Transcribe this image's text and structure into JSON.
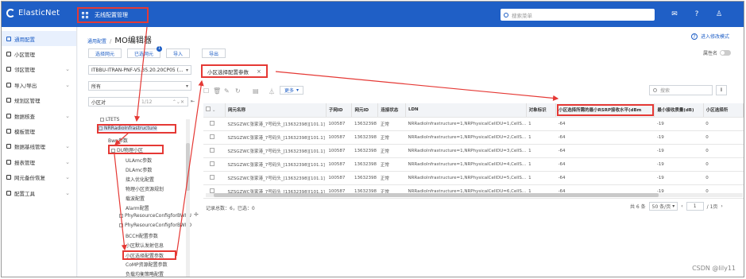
{
  "app": {
    "title": "ElasticNet"
  },
  "topbar": {
    "menu_label": "无线配置管理",
    "search_placeholder": "搜索菜单"
  },
  "sidebar": {
    "items": [
      {
        "label": "通用配置",
        "active": true
      },
      {
        "label": "小区管理"
      },
      {
        "label": "邻区管理"
      },
      {
        "label": "导入/导出"
      },
      {
        "label": "规划区管理"
      },
      {
        "label": "数据核查"
      },
      {
        "label": "模板管理"
      },
      {
        "label": "数据基线管理"
      },
      {
        "label": "报表管理"
      },
      {
        "label": "网元备份恢复"
      },
      {
        "label": "配置工具"
      }
    ]
  },
  "header": {
    "breadcrumb_link": "通用配置",
    "breadcrumb_sep": "/",
    "title": "MO编辑器",
    "help": "进入修改模式",
    "attr_name_label": "属性名"
  },
  "actions": {
    "select_ne": "选择网元",
    "selected_ne": "已选网元",
    "selected_badge": "1",
    "import": "导入",
    "export": "导出"
  },
  "filters": {
    "ne_version": "ITBBU-ITRAN-PNF-V5.35.20.20CP05 (...",
    "scope": "所有",
    "tree_search_value": "小区对",
    "tree_match": "1/12"
  },
  "tree": {
    "nodes": [
      "LTETS",
      "NRRadioInfrastructure",
      "Bwp参数",
      "DU物理小区",
      "ULAmc参数",
      "DLAmc参数",
      "接入优化配置",
      "物理小区资源规划",
      "载波配置",
      "Alarm配置",
      "PhyResourceConfigforBWPU",
      "PhyResourceConfigforBWPD",
      "BCCH配置参数",
      "小区默认发射信息",
      "小区选择配置参数",
      "CoMP资源配置参数",
      "负载均衡策略配置"
    ]
  },
  "tab": {
    "label": "小区选择配置参数"
  },
  "toolbar": {
    "more": "更多",
    "search_placeholder": "搜索"
  },
  "table": {
    "columns": [
      "网元名称",
      "子网ID",
      "网元ID",
      "连接状态",
      "LDN",
      "对象标识",
      "小区选择所需的最小RSRP接收水平(dBm",
      "最小接收质量(dB)",
      "小区选择所"
    ],
    "rows": [
      [
        "SZSGZWC张家港_7号码头_[13632398][101.1]",
        "100587",
        "13632398",
        "正常",
        "NRRadioInfrastructure=1,NRPhysicalCellDU=1,CellS...",
        "1",
        "-64",
        "-19",
        "0"
      ],
      [
        "SZSGZWC张家港_7号码头_[13632398][101.1]",
        "100587",
        "13632398",
        "正常",
        "NRRadioInfrastructure=1,NRPhysicalCellDU=2,CellS...",
        "1",
        "-64",
        "-19",
        "0"
      ],
      [
        "SZSGZWC张家港_7号码头_[13632398][101.1]",
        "100587",
        "13632398",
        "正常",
        "NRRadioInfrastructure=1,NRPhysicalCellDU=3,CellS...",
        "1",
        "-64",
        "-19",
        "0"
      ],
      [
        "SZSGZWC张家港_7号码头_[13632398][101.1]",
        "100587",
        "13632398",
        "正常",
        "NRRadioInfrastructure=1,NRPhysicalCellDU=4,CellS...",
        "1",
        "-64",
        "-19",
        "0"
      ],
      [
        "SZSGZWC张家港_7号码头_[13632398][101.1]",
        "100587",
        "13632398",
        "正常",
        "NRRadioInfrastructure=1,NRPhysicalCellDU=5,CellS...",
        "1",
        "-64",
        "-19",
        "0"
      ],
      [
        "SZSGZWC张家港_7号码头_[13632398][101.1]",
        "100587",
        "13632398",
        "正常",
        "NRRadioInfrastructure=1,NRPhysicalCellDU=6,CellS...",
        "1",
        "-64",
        "-19",
        "0"
      ]
    ]
  },
  "footer": {
    "summary": "记录总数：6，已选：0",
    "total": "共 6 条",
    "page_size": "50 条/页",
    "page": "1",
    "page_total": "/ 1页"
  },
  "watermark": "CSDN @lily11",
  "colors": {
    "brand": "#1f5fc6",
    "highlight": "#e53935"
  }
}
